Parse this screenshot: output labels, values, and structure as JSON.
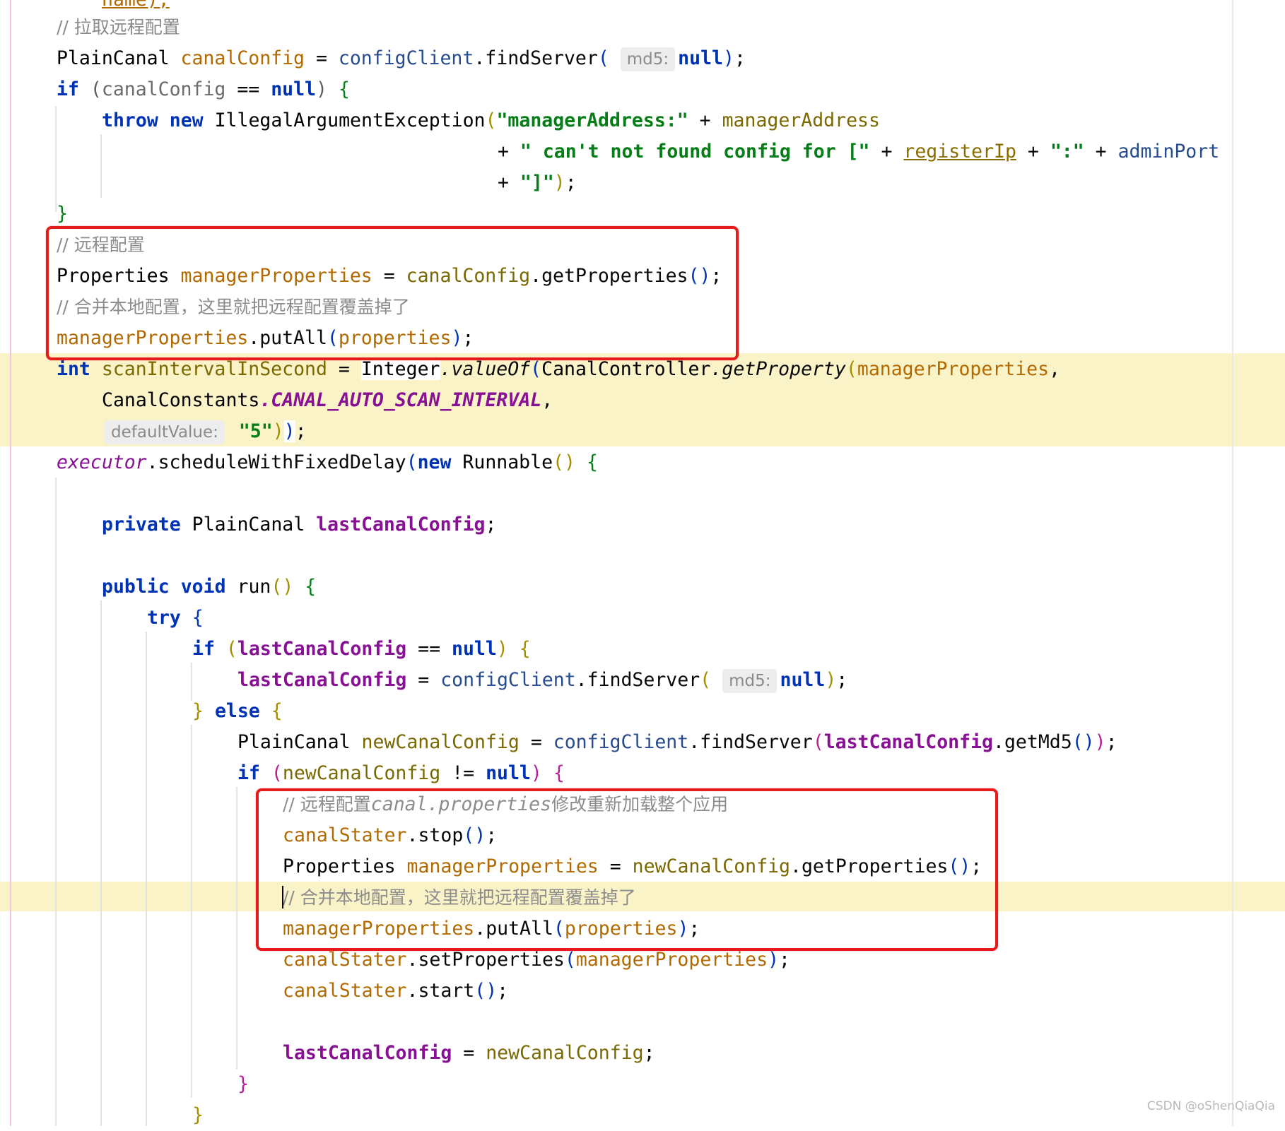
{
  "code": {
    "line0": "name);",
    "line1_comment": "// 拉取远程配置",
    "line2": {
      "type": "PlainCanal",
      "var": "canalConfig",
      "eq": " = ",
      "obj": "configClient",
      "call": ".findServer",
      "hint": "md5:",
      "arg": "null",
      "end": ");"
    },
    "line3": {
      "kw": "if",
      "var": "canalConfig",
      "op": " == ",
      "null": "null"
    },
    "line4": {
      "kw1": "throw",
      "kw2": "new",
      "cls": "IllegalArgumentException",
      "str": "\"managerAddress:\"",
      "plus": " + ",
      "var": "managerAddress"
    },
    "line5": {
      "plus": "+ ",
      "str1": "\" can't not found config for [\"",
      "var1": "registerIp",
      "str2": "\":\"",
      "var2": "adminPort"
    },
    "line6": {
      "plus": "+ ",
      "str": "\"]\"",
      "end": ");"
    },
    "line7": "}",
    "line8_comment": "// 远程配置",
    "line9": {
      "type": "Properties",
      "var": "managerProperties",
      "eq": " = ",
      "obj": "canalConfig",
      "call": ".getProperties",
      "end": ";"
    },
    "line10_comment": "// 合并本地配置，这里就把远程配置覆盖掉了",
    "line11": {
      "var": "managerProperties",
      "call": ".putAll",
      "arg": "properties",
      "end": ";"
    },
    "line12": {
      "kw": "int",
      "var": "scanIntervalInSecond",
      "eq": " = ",
      "cls": "Integer",
      "call": ".valueOf",
      "cls2": "CanalController",
      "call2": ".getProperty",
      "arg": "managerProperties",
      "comma": ","
    },
    "line13": {
      "cls": "CanalConstants",
      "const": ".CANAL_AUTO_SCAN_INTERVAL",
      "comma": ","
    },
    "line14": {
      "hint": "defaultValue:",
      "str": "\"5\"",
      "end": ";"
    },
    "line15": {
      "var": "executor",
      "call": ".scheduleWithFixedDelay",
      "kw": "new",
      "cls": "Runnable"
    },
    "line17": {
      "kw": "private",
      "type": "PlainCanal",
      "var": "lastCanalConfig",
      "end": ";"
    },
    "line19": {
      "kw1": "public",
      "kw2": "void",
      "name": "run"
    },
    "line20": {
      "kw": "try"
    },
    "line21": {
      "kw": "if",
      "var": "lastCanalConfig",
      "op": " == ",
      "null": "null"
    },
    "line22": {
      "var": "lastCanalConfig",
      "eq": " = ",
      "obj": "configClient",
      "call": ".findServer",
      "hint": "md5:",
      "arg": "null",
      "end": ");"
    },
    "line23": {
      "kw": "else"
    },
    "line24": {
      "type": "PlainCanal",
      "var": "newCanalConfig",
      "eq": " = ",
      "obj": "configClient",
      "call": ".findServer",
      "arg": "lastCanalConfig",
      "call2": ".getMd5",
      "end": ";"
    },
    "line25": {
      "kw": "if",
      "var": "newCanalConfig",
      "op": " != ",
      "null": "null"
    },
    "line26_comment_a": "// 远程配置",
    "line26_comment_b": "canal.properties",
    "line26_comment_c": "修改重新加载整个应用",
    "line27": {
      "var": "canalStater",
      "call": ".stop",
      "end": ";"
    },
    "line28": {
      "type": "Properties",
      "var": "managerProperties",
      "eq": " = ",
      "obj": "newCanalConfig",
      "call": ".getProperties",
      "end": ";"
    },
    "line29_comment": "// 合并本地配置，这里就把远程配置覆盖掉了",
    "line30": {
      "var": "managerProperties",
      "call": ".putAll",
      "arg": "properties",
      "end": ";"
    },
    "line31": {
      "var": "canalStater",
      "call": ".setProperties",
      "arg": "managerProperties",
      "end": ";"
    },
    "line32": {
      "var": "canalStater",
      "call": ".start",
      "end": ";"
    },
    "line34": {
      "var": "lastCanalConfig",
      "eq": " = ",
      "val": "newCanalConfig",
      "end": ";"
    },
    "line35": "}",
    "line36": "}"
  },
  "watermark": "CSDN @oShenQiaQia",
  "colors": {
    "keyword": "#0033b3",
    "field": "#b26a00",
    "string": "#067d17",
    "comment": "#8c8c8c",
    "highlight": "#fbf3c8",
    "annotation_box": "#e51c1c"
  }
}
